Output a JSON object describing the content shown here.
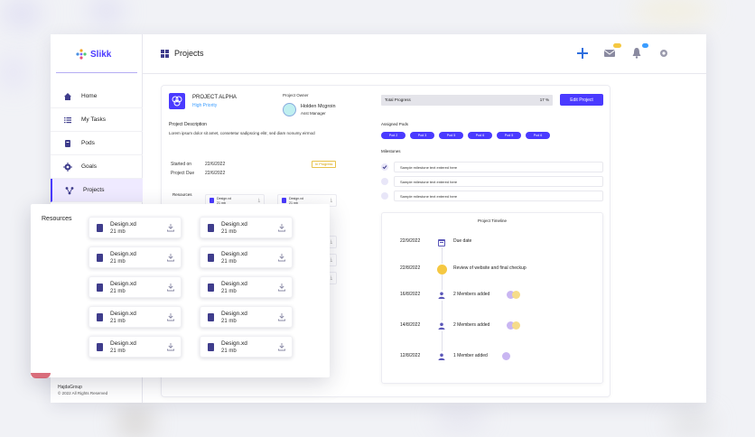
{
  "app": {
    "logo_text": "Slikk",
    "page_title": "Projects",
    "footer_brand": "HajdaGroup",
    "footer_copy": "© 2022 All Rights Reserved"
  },
  "nav": {
    "items": [
      {
        "label": "Home",
        "icon": "home-icon"
      },
      {
        "label": "My Tasks",
        "icon": "list-icon"
      },
      {
        "label": "Pods",
        "icon": "pods-icon"
      },
      {
        "label": "Goals",
        "icon": "target-icon"
      },
      {
        "label": "Projects",
        "icon": "projects-icon",
        "active": true
      }
    ]
  },
  "project": {
    "name": "PROJECT ALPHA",
    "priority": "High Priority",
    "owner_label": "Project Owner",
    "owner_name": "Holden Mcgroin",
    "owner_role": "Asst Manager",
    "description_label": "Project Description",
    "description": "Lorem ipsum dolor sit amet, consetetur sadipscing elitr, sed diam nonumy eirmod",
    "started_label": "Started on",
    "started_value": "22/6/2022",
    "due_label": "Project Due",
    "due_value": "22/6/2022",
    "status_tag": "In Progress",
    "resources_label": "Resources",
    "total_progress_label": "Total Progress",
    "total_progress_value": "17 %",
    "edit_button": "Edit Project",
    "assigned_pods_label": "Assigned Pods",
    "pods": [
      "Pod 2",
      "Pod 3",
      "Pod 5",
      "Pod 6",
      "Pod 5",
      "Pod 6"
    ],
    "milestones_label": "Milestones",
    "milestones": [
      {
        "text": "Sample milestone text entered here",
        "done": true
      },
      {
        "text": "Sample milestone text entered here",
        "done": false
      },
      {
        "text": "Sample milestone text entered here",
        "done": false
      }
    ]
  },
  "mini_files": [
    {
      "name": "Design.xd",
      "size": "21 mb"
    },
    {
      "name": "Design.xd",
      "size": "21 mb"
    }
  ],
  "timeline": {
    "title": "Project Timeline",
    "events": [
      {
        "date": "22/9/2022",
        "text": "Due date",
        "icon": "calendar-icon"
      },
      {
        "date": "22/8/2022",
        "text": "Review of website and final checkup",
        "icon": "dot-icon"
      },
      {
        "date": "16/8/2022",
        "text": "2 Members added",
        "icon": "user-icon"
      },
      {
        "date": "14/8/2022",
        "text": "2 Members added",
        "icon": "user-icon"
      },
      {
        "date": "12/8/2022",
        "text": "1 Member added",
        "icon": "user-icon"
      }
    ]
  },
  "resources_popup": {
    "title": "Resources",
    "files": [
      {
        "name": "Design.xd",
        "size": "21 mb"
      },
      {
        "name": "Design.xd",
        "size": "21 mb"
      },
      {
        "name": "Design.xd",
        "size": "21 mb"
      },
      {
        "name": "Design.xd",
        "size": "21 mb"
      },
      {
        "name": "Design.xd",
        "size": "21 mb"
      },
      {
        "name": "Design.xd",
        "size": "21 mb"
      },
      {
        "name": "Design.xd",
        "size": "21 mb"
      },
      {
        "name": "Design.xd",
        "size": "21 mb"
      },
      {
        "name": "Design.xd",
        "size": "21 mb"
      },
      {
        "name": "Design.xd",
        "size": "21 mb"
      }
    ]
  },
  "colors": {
    "accent": "#4a3aff",
    "priority": "#3b9dff",
    "review_dot": "#f5c842",
    "avatar_purple": "#c9b6f2",
    "avatar_yellow": "#f6dc8a"
  }
}
